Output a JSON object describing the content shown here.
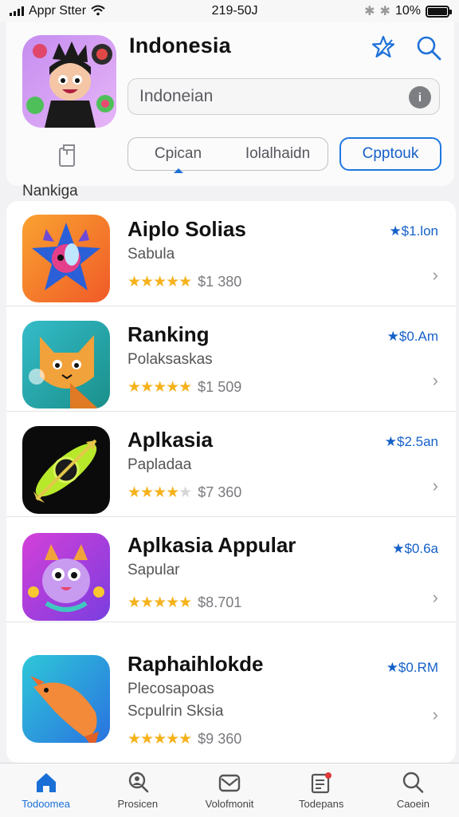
{
  "status_bar": {
    "carrier": "Appr Stter",
    "time": "219-50J",
    "battery": "10%"
  },
  "header": {
    "title": "Indonesia",
    "search": {
      "value": "Indoneian"
    },
    "segments": [
      "Cpican",
      "Iolalhaidn"
    ],
    "option_button": "Cpptouk",
    "section_label": "Nankiga"
  },
  "apps": [
    {
      "name": "Aiplo Solias",
      "subtitle": "Sabula",
      "subtitle2": "",
      "price": "$1 380",
      "tag": "★$1.lon",
      "rating": 5,
      "icon": "star-creature-icon"
    },
    {
      "name": "Ranking",
      "subtitle": "Polaksaskas",
      "subtitle2": "",
      "price": "$1 509",
      "tag": "★$0.Am",
      "rating": 5,
      "icon": "cat-icon"
    },
    {
      "name": "Aplkasia",
      "subtitle": "Papladaa",
      "subtitle2": "",
      "price": "$7 360",
      "tag": "★$2.5an",
      "rating": 4,
      "icon": "arrow-disc-icon"
    },
    {
      "name": "Aplkasia Appular",
      "subtitle": "Sapular",
      "subtitle2": "",
      "price": "$8.701",
      "tag": "★$0.6a",
      "rating": 5,
      "icon": "owl-creature-icon"
    },
    {
      "name": "Raphaihlokde",
      "subtitle": "Plecosapoas",
      "subtitle2": "Scpulrin Sksia",
      "price": "$9 360",
      "tag": "★$0.RM",
      "rating": 5,
      "icon": "fish-icon"
    }
  ],
  "tabs": [
    {
      "label": "Todoomea",
      "icon": "home-icon",
      "active": true
    },
    {
      "label": "Prosicen",
      "icon": "search-person-icon",
      "active": false
    },
    {
      "label": "Volofmonit",
      "icon": "mail-icon",
      "active": false
    },
    {
      "label": "Todepans",
      "icon": "document-badge-icon",
      "active": false
    },
    {
      "label": "Caoein",
      "icon": "search-icon",
      "active": false
    }
  ],
  "colors": {
    "accent": "#1560c8",
    "star": "#f5b21c"
  }
}
